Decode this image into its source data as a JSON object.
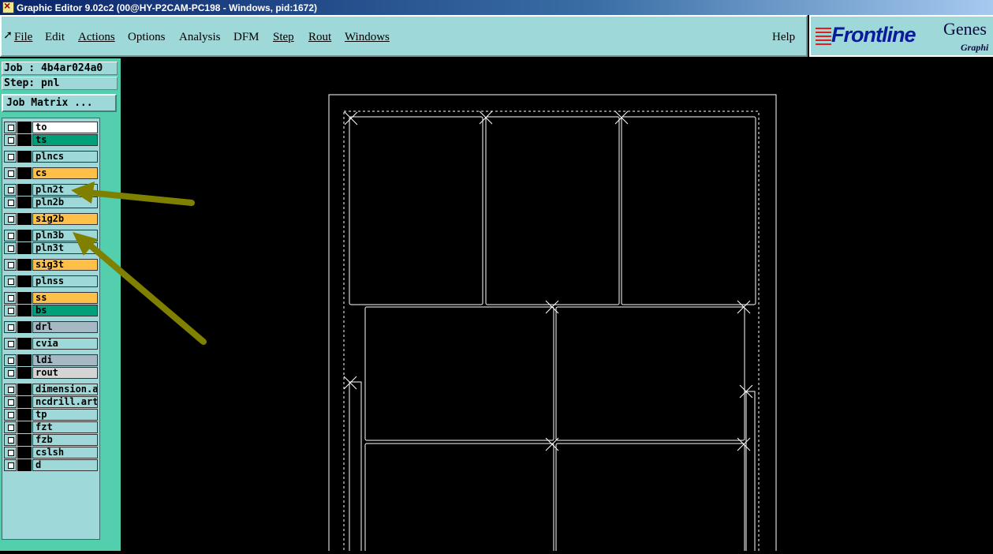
{
  "window": {
    "title": "Graphic Editor 9.02c2 (00@HY-P2CAM-PC198 - Windows, pid:1672)"
  },
  "menu": [
    {
      "label": "File",
      "ul": true
    },
    {
      "label": "Edit",
      "ul": false
    },
    {
      "label": "Actions",
      "ul": true
    },
    {
      "label": "Options",
      "ul": false
    },
    {
      "label": "Analysis",
      "ul": false
    },
    {
      "label": "DFM",
      "ul": false
    },
    {
      "label": "Step",
      "ul": true
    },
    {
      "label": "Rout",
      "ul": true
    },
    {
      "label": "Windows",
      "ul": true
    },
    {
      "label": "Help",
      "ul": false
    }
  ],
  "logo": {
    "brand": "Frontline",
    "product": "Genes",
    "sub": "Graphi"
  },
  "job": {
    "label": "Job : 4b4ar024a0",
    "step": "Step: pnl",
    "matrix_button": "Job Matrix ..."
  },
  "layers": [
    {
      "name": "to",
      "color": "#ffffff"
    },
    {
      "name": "ts",
      "color": "#00a07a"
    },
    {
      "name": "plncs",
      "color": "#9ed8d8"
    },
    {
      "name": "cs",
      "color": "#ffc04a"
    },
    {
      "name": "pln2t",
      "color": "#9ed8d8"
    },
    {
      "name": "pln2b",
      "color": "#9ed8d8"
    },
    {
      "name": "sig2b",
      "color": "#ffc04a"
    },
    {
      "name": "pln3b",
      "color": "#9ed8d8"
    },
    {
      "name": "pln3t",
      "color": "#9ed8d8"
    },
    {
      "name": "sig3t",
      "color": "#ffc04a"
    },
    {
      "name": "plnss",
      "color": "#9ed8d8"
    },
    {
      "name": "ss",
      "color": "#ffc04a"
    },
    {
      "name": "bs",
      "color": "#00a07a"
    },
    {
      "name": "drl",
      "color": "#a6b8c4"
    },
    {
      "name": "cvia",
      "color": "#9ed8d8"
    },
    {
      "name": "ldi",
      "color": "#a6b8c4"
    },
    {
      "name": "rout",
      "color": "#d4d4d4"
    },
    {
      "name": "dimension.ar",
      "color": "#9ed8d8"
    },
    {
      "name": "ncdrill.art",
      "color": "#9ed8d8"
    },
    {
      "name": "tp",
      "color": "#9ed8d8"
    },
    {
      "name": "fzt",
      "color": "#9ed8d8"
    },
    {
      "name": "fzb",
      "color": "#9ed8d8"
    },
    {
      "name": "cslsh",
      "color": "#9ed8d8"
    },
    {
      "name": "d",
      "color": "#9ed8d8"
    }
  ],
  "annotation_color": "#808000"
}
